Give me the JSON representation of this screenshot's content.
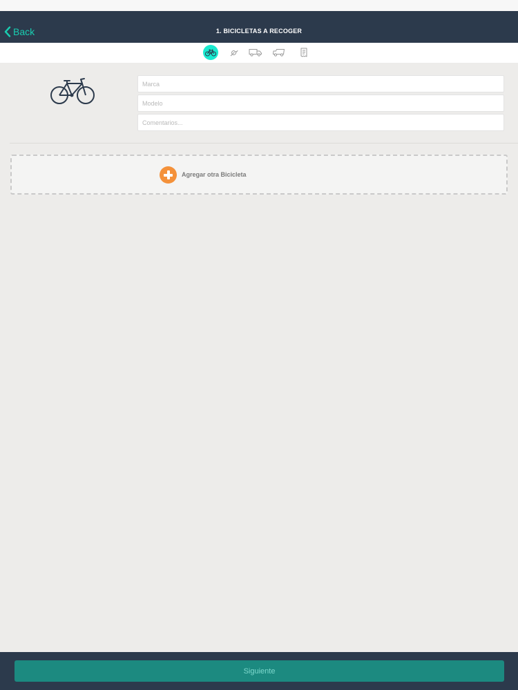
{
  "nav": {
    "back_label": "Back",
    "title": "1. BICICLETAS A RECOGER"
  },
  "steps": [
    {
      "icon": "bicycle-icon",
      "active": true
    },
    {
      "icon": "wrench-icon",
      "active": false
    },
    {
      "icon": "truck-icon",
      "active": false
    },
    {
      "icon": "delivery-truck-icon",
      "active": false
    },
    {
      "icon": "receipt-icon",
      "active": false
    }
  ],
  "bike_form": {
    "image_icon": "bicycle-icon",
    "brand_placeholder": "Marca",
    "model_placeholder": "Modelo",
    "comments_placeholder": "Comentarios..."
  },
  "add_bike": {
    "label": "Agregar otra Bicicleta",
    "icon": "plus-circle-icon"
  },
  "footer": {
    "next_label": "Siguiente"
  },
  "colors": {
    "nav_bg": "#2c3a4c",
    "accent": "#19ead0",
    "add_orange": "#f4913a",
    "next_button": "#1c8a80"
  }
}
